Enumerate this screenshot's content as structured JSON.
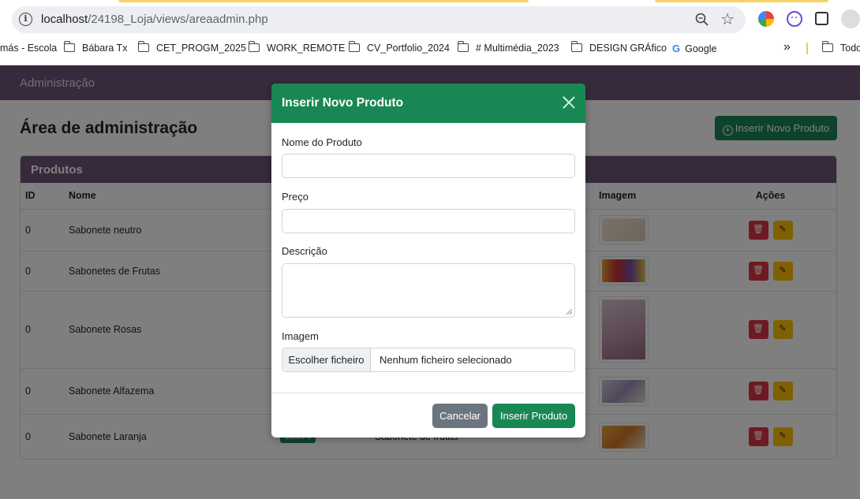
{
  "browser": {
    "url_host": "localhost",
    "url_path": "/24198_Loja/views/areaadmin.php",
    "bookmarks": [
      "más - Escola",
      "Bábara Tx",
      "CET_PROGM_2025",
      "WORK_REMOTE",
      "CV_Portfolio_2024",
      "# Multimédia_2023",
      "DESIGN GRÁfico",
      "Google",
      "Todo"
    ]
  },
  "navbar": {
    "brand": "Administração"
  },
  "page": {
    "title": "Área de administração",
    "new_button": "Inserir Novo Produto"
  },
  "products_card": {
    "header": "Produtos",
    "columns": {
      "id": "ID",
      "nome": "Nome",
      "imagem": "Imagem",
      "acoes": "Ações"
    },
    "rows": [
      {
        "id": "0",
        "nome": "Sabonete neutro"
      },
      {
        "id": "0",
        "nome": "Sabonetes de Frutas"
      },
      {
        "id": "0",
        "nome": "Sabonete Rosas"
      },
      {
        "id": "0",
        "nome": "Sabonete Alfazema"
      },
      {
        "id": "0",
        "nome": "Sabonete Laranja",
        "preco": "10,99 €",
        "descricao": "Sabonete de frutas"
      }
    ]
  },
  "modal": {
    "title": "Inserir Novo Produto",
    "fields": {
      "nome_label": "Nome do Produto",
      "nome_value": "",
      "preco_label": "Preço",
      "preco_value": "",
      "descricao_label": "Descrição",
      "descricao_value": "",
      "imagem_label": "Imagem",
      "file_button": "Escolher ficheiro",
      "file_status": "Nenhum ficheiro selecionado"
    },
    "cancel_button": "Cancelar",
    "submit_button": "Inserir Produto"
  },
  "colors": {
    "navbar": "#6f5479",
    "success": "#198754",
    "danger": "#dc3545",
    "warning": "#ffc107",
    "secondary": "#6c757d"
  }
}
